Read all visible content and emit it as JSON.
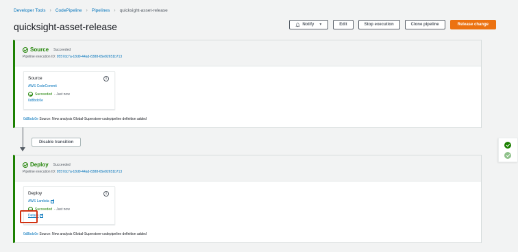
{
  "breadcrumb": {
    "items": [
      "Developer Tools",
      "CodePipeline",
      "Pipelines"
    ],
    "current": "quicksight-asset-release"
  },
  "header": {
    "title": "quicksight-asset-release",
    "buttons": {
      "notify": "Notify",
      "edit": "Edit",
      "stop": "Stop execution",
      "clone": "Clone pipeline",
      "release": "Release change"
    }
  },
  "stages": [
    {
      "name": "Source",
      "status": "Succeeded",
      "exec_label": "Pipeline execution ID:",
      "exec_id": "9557dc7a-18d0-44ad-8388-65e82651b713",
      "action": {
        "name": "Source",
        "provider": "AWS CodeCommit",
        "status": "Succeeded",
        "time": "- Just now",
        "link": "0d8bdc0e"
      },
      "revision_id": "0d8bdc0e",
      "revision_text": "Source: New analysis Global-Superstore-codepipeline definition added"
    },
    {
      "name": "Deploy",
      "status": "Succeeded",
      "exec_label": "Pipeline execution ID:",
      "exec_id": "9557dc7a-18d0-44ad-8388-65e82651b713",
      "action": {
        "name": "Deploy",
        "provider": "AWS Lambda",
        "status": "Succeeded",
        "time": "- Just now",
        "link": "Details"
      },
      "revision_id": "0d8bdc0e",
      "revision_text": "Source: New analysis Global-Superstore-codepipeline definition added"
    }
  ],
  "transition": {
    "label": "Disable transition"
  },
  "colors": {
    "success": "#1d8102",
    "link": "#0073bb",
    "primary": "#ec7211",
    "highlight": "#d13212",
    "success_light": "#8fc18a"
  },
  "icons": {
    "notify": "bell-icon",
    "status": "check-circle-icon",
    "info": "info-icon",
    "external": "external-link-icon"
  }
}
